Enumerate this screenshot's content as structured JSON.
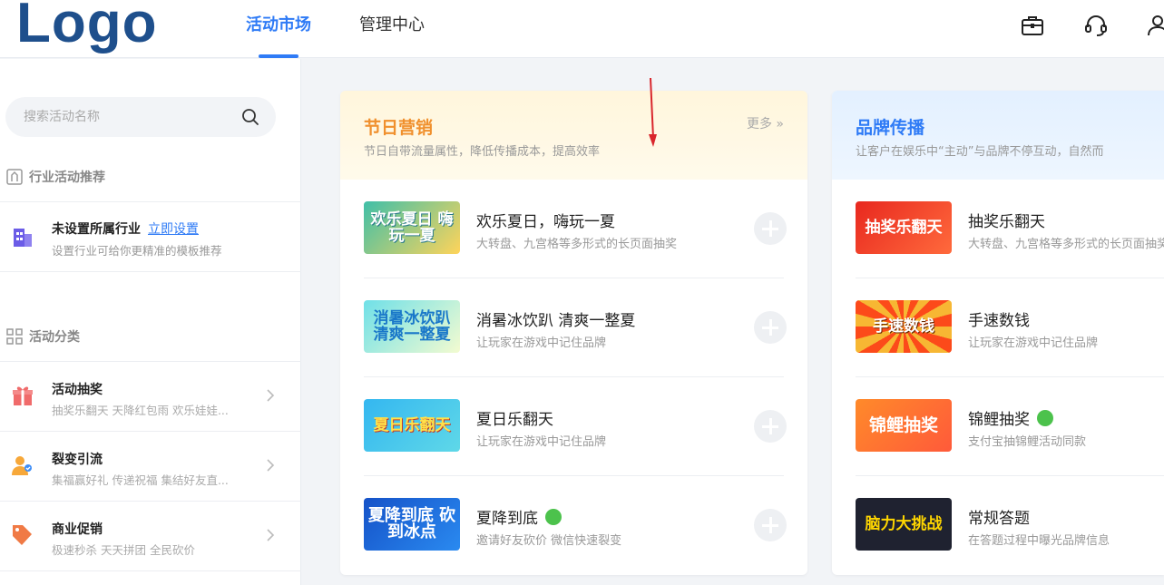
{
  "header": {
    "logo": "Logo",
    "tabs": [
      {
        "label": "活动市场",
        "active": true
      },
      {
        "label": "管理中心",
        "active": false
      }
    ],
    "icons": [
      "briefcase-icon",
      "headset-icon",
      "user-icon"
    ],
    "accent": "#2f7bf6"
  },
  "sidebar": {
    "search_placeholder": "搜索活动名称",
    "industry_section": "行业活动推荐",
    "industry": {
      "title": "未设置所属行业",
      "link": "立即设置",
      "desc": "设置行业可给你更精准的模板推荐"
    },
    "category_section": "活动分类",
    "categories": [
      {
        "title": "活动抽奖",
        "desc": "抽奖乐翻天   天降红包雨   欢乐娃娃...",
        "icon": "gift-icon",
        "color": "#f06b6b"
      },
      {
        "title": "裂变引流",
        "desc": "集福赢好礼   传递祝福   集结好友直...",
        "icon": "users-icon",
        "color": "#f7a83a"
      },
      {
        "title": "商业促销",
        "desc": "极速秒杀   天天拼团   全民砍价",
        "icon": "tag-icon",
        "color": "#f07a45"
      }
    ]
  },
  "cards": [
    {
      "title": "节日营销",
      "subtitle": "节日自带流量属性，降低传播成本，提高效率",
      "more": "更多",
      "title_color": "#f0902d",
      "items": [
        {
          "title": "欢乐夏日，嗨玩一夏",
          "desc": "大转盘、九宫格等多形式的长页面抽奖",
          "thumb": "欢乐夏日 嗨玩一夏",
          "badge": false
        },
        {
          "title": "消暑冰饮趴 清爽一整夏",
          "desc": "让玩家在游戏中记住品牌",
          "thumb": "消暑冰饮趴 清爽一整夏",
          "badge": false
        },
        {
          "title": "夏日乐翻天",
          "desc": "让玩家在游戏中记住品牌",
          "thumb": "夏日乐翻天",
          "badge": false
        },
        {
          "title": "夏降到底",
          "desc": "邀请好友砍价 微信快速裂变",
          "thumb": "夏降到底 砍到冰点",
          "badge": true
        }
      ]
    },
    {
      "title": "品牌传播",
      "subtitle": "让客户在娱乐中“主动”与品牌不停互动，自然而",
      "title_color": "#2f7bf6",
      "items": [
        {
          "title": "抽奖乐翻天",
          "desc": "大转盘、九宫格等多形式的长页面抽奖",
          "thumb": "抽奖乐翻天",
          "badge": false
        },
        {
          "title": "手速数钱",
          "desc": "让玩家在游戏中记住品牌",
          "thumb": "手速数钱",
          "badge": false
        },
        {
          "title": "锦鲤抽奖",
          "desc": "支付宝抽锦鲤活动同款",
          "thumb": "锦鲤抽奖",
          "badge": true
        },
        {
          "title": "常规答题",
          "desc": "在答题过程中曝光品牌信息",
          "thumb": "脑力大挑战",
          "badge": false
        }
      ]
    }
  ]
}
